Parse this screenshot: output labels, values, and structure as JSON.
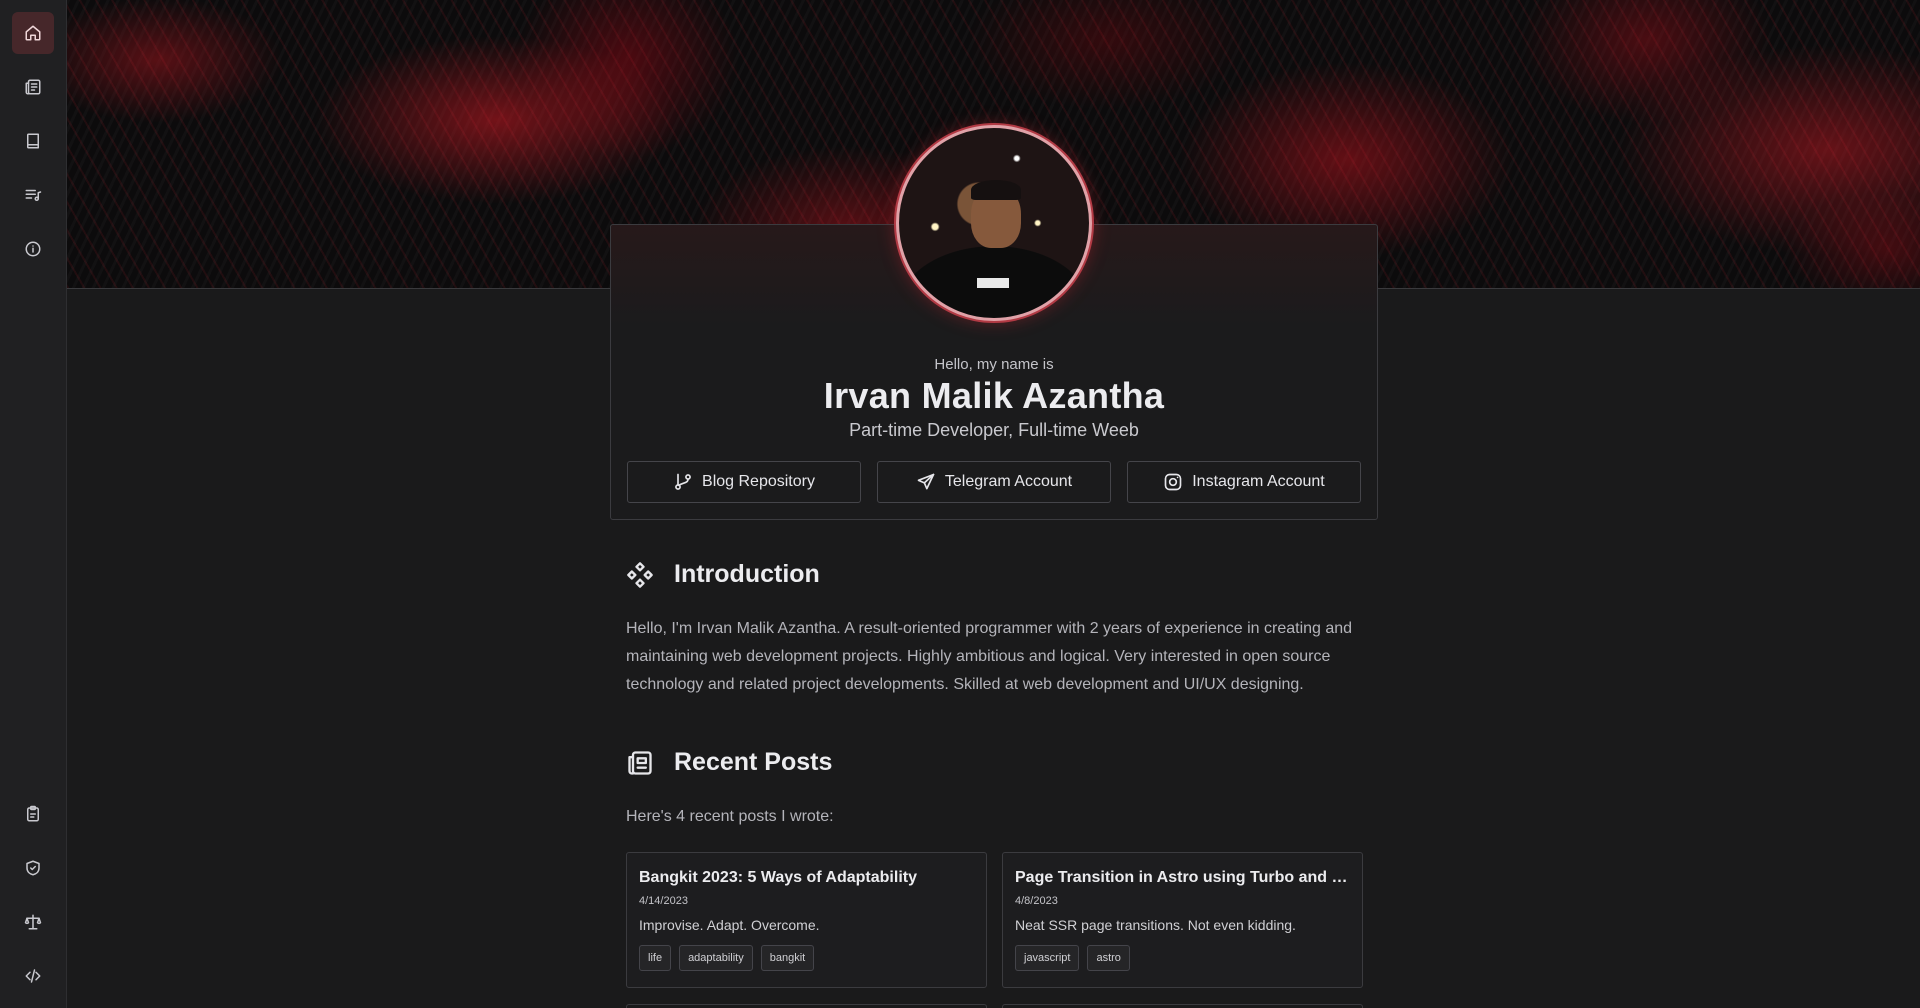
{
  "sidebar": {
    "top_items": [
      {
        "icon": "home-icon",
        "active": true
      },
      {
        "icon": "posts-icon"
      },
      {
        "icon": "book-icon"
      },
      {
        "icon": "playlist-icon"
      },
      {
        "icon": "info-icon"
      }
    ],
    "bottom_items": [
      {
        "icon": "clipboard-icon"
      },
      {
        "icon": "shield-check-icon"
      },
      {
        "icon": "scale-icon"
      },
      {
        "icon": "code-icon"
      }
    ]
  },
  "profile": {
    "greeting": "Hello, my name is",
    "name": "Irvan Malik Azantha",
    "tagline": "Part-time Developer, Full-time Weeb",
    "links": [
      {
        "label": "Blog Repository",
        "icon": "git-branch-icon"
      },
      {
        "label": "Telegram Account",
        "icon": "send-icon"
      },
      {
        "label": "Instagram Account",
        "icon": "instagram-icon"
      }
    ]
  },
  "introduction": {
    "title": "Introduction",
    "icon": "components-icon",
    "body": "Hello, I'm Irvan Malik Azantha. A result-oriented programmer with 2 years of experience in creating and maintaining web development projects. Highly ambitious and logical. Very interested in open source technology and related project developments. Skilled at web development and UI/UX designing."
  },
  "recent_posts": {
    "title": "Recent Posts",
    "icon": "newspaper-icon",
    "intro": "Here's 4 recent posts I wrote:",
    "posts": [
      {
        "title": "Bangkit 2023: 5 Ways of Adaptability",
        "date": "4/14/2023",
        "description": "Improvise. Adapt. Overcome.",
        "tags": [
          "life",
          "adaptability",
          "bangkit"
        ]
      },
      {
        "title": "Page Transition in Astro using Turbo and T...",
        "date": "4/8/2023",
        "description": "Neat SSR page transitions. Not even kidding.",
        "tags": [
          "javascript",
          "astro"
        ]
      }
    ]
  },
  "colors": {
    "background": "#1a1a1b",
    "accent": "#b23a44",
    "active_nav": "#46272a"
  }
}
